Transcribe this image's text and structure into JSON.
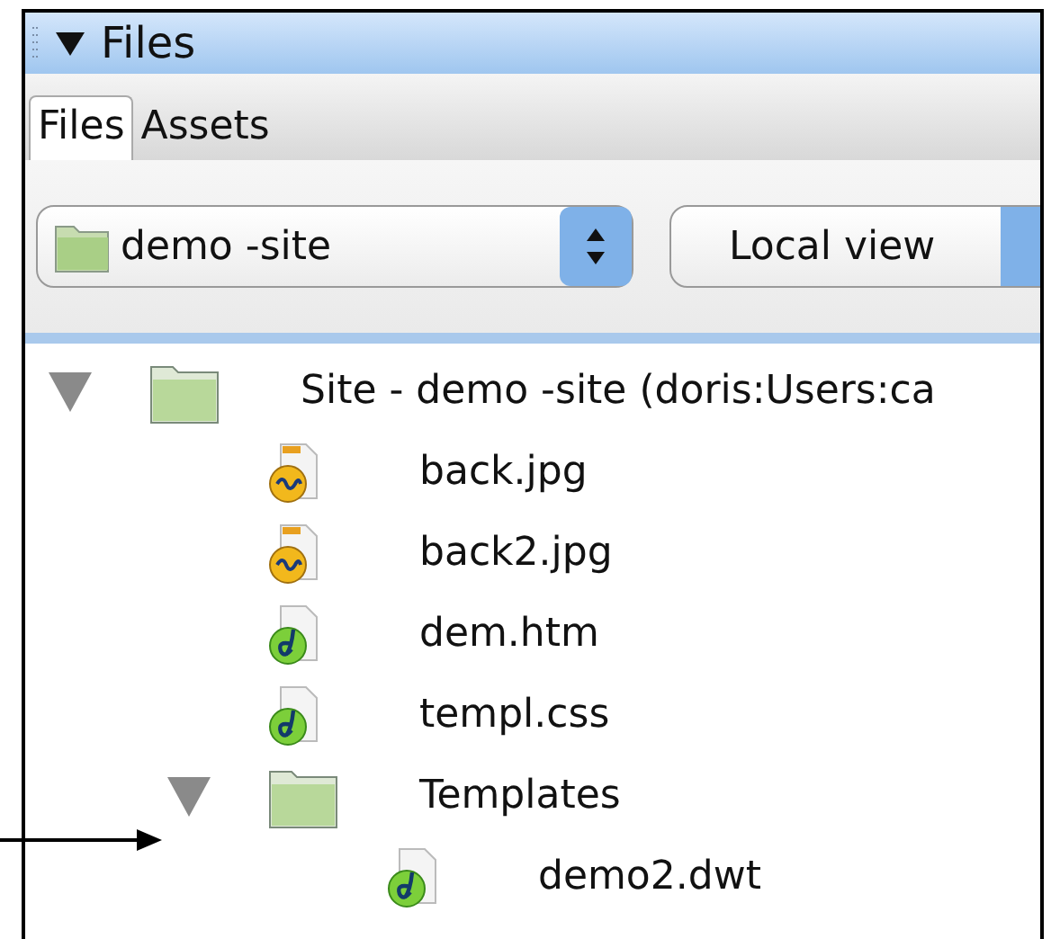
{
  "panel": {
    "title": "Files",
    "expanded": true
  },
  "tabs": [
    {
      "label": "Files",
      "selected": true
    },
    {
      "label": "Assets",
      "selected": false
    }
  ],
  "toolbar": {
    "site_select": "demo -site",
    "view_select": "Local view"
  },
  "tree": [
    {
      "label": "Site - demo -site (doris:Users:ca",
      "kind": "folder",
      "expanded": true,
      "children": [
        {
          "label": "back.jpg",
          "kind": "image"
        },
        {
          "label": "back2.jpg",
          "kind": "image"
        },
        {
          "label": "dem.htm",
          "kind": "page"
        },
        {
          "label": "templ.css",
          "kind": "page"
        },
        {
          "label": "Templates",
          "kind": "folder",
          "expanded": true,
          "children": [
            {
              "label": "demo2.dwt",
              "kind": "page"
            }
          ]
        }
      ]
    }
  ]
}
